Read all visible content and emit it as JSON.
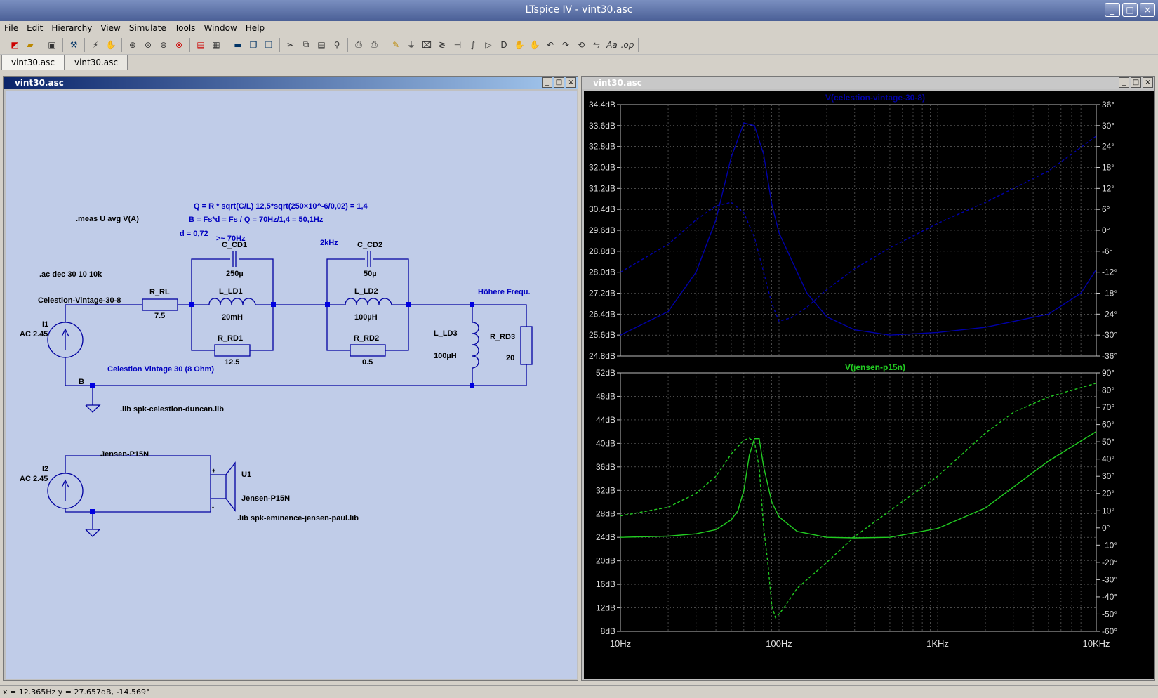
{
  "app": {
    "title": "LTspice IV - vint30.asc"
  },
  "menu": [
    "File",
    "Edit",
    "Hierarchy",
    "View",
    "Simulate",
    "Tools",
    "Window",
    "Help"
  ],
  "tabs": [
    "vint30.asc",
    "vint30.asc"
  ],
  "schematic_window": {
    "title": "vint30.asc"
  },
  "waveform_window": {
    "title": "vint30.asc"
  },
  "schematic": {
    "directives": {
      "q_formula": "Q = R * sqrt(C/L)    12,5*sqrt(250×10^-6/0,02) = 1,4",
      "b_formula": "B = Fs*d = Fs / Q = 70Hz/1,4 = 50,1Hz",
      "meas": ".meas U avg V(A)",
      "d_value": "d = 0,72",
      "fs_note": ">~ 70Hz",
      "freq_2k": "2kHz",
      "ac": ".ac dec 30 10 10k",
      "lib1": ".lib spk-celestion-duncan.lib",
      "lib2": ".lib spk-eminence-jensen-paul.lib"
    },
    "labels": {
      "net_celestion": "Celestion-Vintage-30-8",
      "net_higher": "Höhere Frequ.",
      "celestion_caption": "Celestion Vintage 30 (8 Ohm)",
      "node_b": "B",
      "net_jensen": "Jensen-P15N",
      "u1_name": "U1",
      "u1_value": "Jensen-P15N"
    },
    "components": {
      "i1_name": "I1",
      "i1_value": "AC 2.45",
      "i2_name": "I2",
      "i2_value": "AC 2.45",
      "r_rl_name": "R_RL",
      "r_rl_value": "7.5",
      "c_cd1_name": "C_CD1",
      "c_cd1_value": "250µ",
      "l_ld1_name": "L_LD1",
      "l_ld1_value": "20mH",
      "r_rd1_name": "R_RD1",
      "r_rd1_value": "12.5",
      "c_cd2_name": "C_CD2",
      "c_cd2_value": "50µ",
      "l_ld2_name": "L_LD2",
      "l_ld2_value": "100µH",
      "r_rd2_name": "R_RD2",
      "r_rd2_value": "0.5",
      "l_ld3_name": "L_LD3",
      "l_ld3_value": "100µH",
      "r_rd3_name": "R_RD3",
      "r_rd3_value": "20"
    }
  },
  "statusbar": {
    "text": "x = 12.365Hz    y = 27.657dB, -14.569°"
  },
  "chart_data": [
    {
      "type": "line",
      "title": "V(celestion-vintage-30-8)",
      "color": "#0000a8",
      "x_scale": "log",
      "xlim": [
        10,
        10000
      ],
      "ylim": [
        24.8,
        34.4
      ],
      "y_ticks": [
        "34.4dB",
        "33.6dB",
        "32.8dB",
        "32.0dB",
        "31.2dB",
        "30.4dB",
        "29.6dB",
        "28.8dB",
        "28.0dB",
        "27.2dB",
        "26.4dB",
        "25.6dB",
        "24.8dB"
      ],
      "y2lim": [
        -36,
        36
      ],
      "y2_ticks": [
        "36°",
        "30°",
        "24°",
        "18°",
        "12°",
        "6°",
        "0°",
        "-6°",
        "-12°",
        "-18°",
        "-24°",
        "-30°",
        "-36°"
      ],
      "grid": true,
      "series": [
        {
          "style": "solid",
          "axis": "left",
          "x": [
            10,
            20,
            30,
            40,
            50,
            60,
            70,
            80,
            90,
            100,
            150,
            200,
            300,
            500,
            1000,
            2000,
            5000,
            8000,
            10000
          ],
          "values": [
            25.6,
            26.5,
            28.0,
            30.0,
            32.4,
            33.7,
            33.6,
            32.5,
            30.6,
            29.5,
            27.2,
            26.3,
            25.8,
            25.6,
            25.7,
            25.9,
            26.4,
            27.2,
            28.1
          ]
        },
        {
          "style": "dashed",
          "axis": "right",
          "x": [
            10,
            20,
            30,
            40,
            50,
            60,
            70,
            80,
            90,
            100,
            120,
            150,
            200,
            300,
            500,
            1000,
            2000,
            5000,
            10000
          ],
          "values": [
            -12,
            -4,
            3,
            7,
            8,
            5,
            -2,
            -12,
            -21,
            -26,
            -25,
            -22,
            -17,
            -11,
            -5,
            2,
            8,
            17,
            27
          ]
        }
      ]
    },
    {
      "type": "line",
      "title": "V(jensen-p15n)",
      "color": "#22cc22",
      "x_scale": "log",
      "xlim": [
        10,
        10000
      ],
      "x_ticks": [
        "10Hz",
        "100Hz",
        "1KHz",
        "10KHz"
      ],
      "ylim": [
        8,
        52
      ],
      "y_ticks": [
        "52dB",
        "48dB",
        "44dB",
        "40dB",
        "36dB",
        "32dB",
        "28dB",
        "24dB",
        "20dB",
        "16dB",
        "12dB",
        "8dB"
      ],
      "y2lim": [
        -60,
        90
      ],
      "y2_ticks": [
        "90°",
        "80°",
        "70°",
        "60°",
        "50°",
        "40°",
        "30°",
        "20°",
        "10°",
        "0°",
        "-10°",
        "-20°",
        "-30°",
        "-40°",
        "-50°",
        "-60°"
      ],
      "grid": true,
      "series": [
        {
          "style": "solid",
          "axis": "left",
          "x": [
            10,
            20,
            30,
            40,
            50,
            55,
            60,
            65,
            70,
            75,
            80,
            90,
            100,
            130,
            200,
            300,
            500,
            1000,
            2000,
            5000,
            10000
          ],
          "values": [
            24,
            24.2,
            24.6,
            25.3,
            27,
            28.5,
            32,
            38,
            40.8,
            40.8,
            36,
            30,
            27.5,
            25,
            24,
            23.9,
            24,
            25.5,
            29,
            37,
            42
          ]
        },
        {
          "style": "dashed",
          "axis": "right",
          "x": [
            10,
            20,
            30,
            40,
            50,
            60,
            65,
            70,
            75,
            80,
            85,
            90,
            95,
            100,
            110,
            130,
            200,
            300,
            500,
            1000,
            2000,
            3000,
            5000,
            10000
          ],
          "values": [
            7,
            12,
            20,
            30,
            43,
            51,
            52,
            50,
            35,
            0,
            -20,
            -45,
            -52,
            -50,
            -45,
            -35,
            -20,
            -5,
            10,
            30,
            55,
            67,
            76,
            84
          ]
        }
      ]
    }
  ]
}
